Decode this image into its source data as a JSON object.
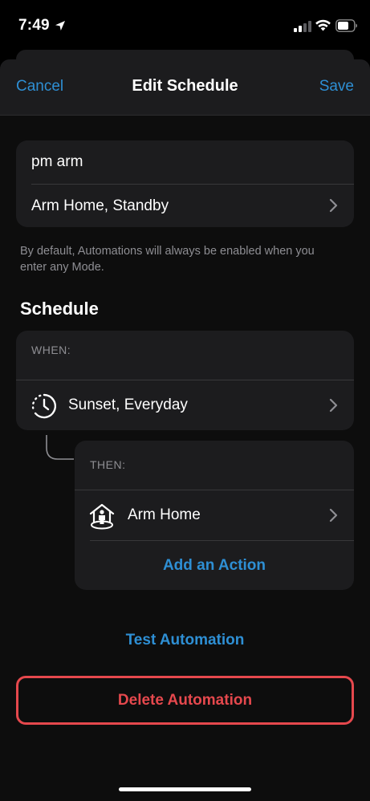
{
  "status_bar": {
    "time": "7:49"
  },
  "nav": {
    "cancel": "Cancel",
    "title": "Edit Schedule",
    "save": "Save"
  },
  "automation": {
    "name": "pm arm",
    "modes": "Arm Home, Standby",
    "footnote": "By default, Automations will always be enabled when you enter any Mode."
  },
  "schedule": {
    "title": "Schedule",
    "when_label": "WHEN:",
    "when_value": "Sunset, Everyday",
    "then_label": "THEN:",
    "then_value": "Arm Home",
    "add_action": "Add an Action"
  },
  "buttons": {
    "test": "Test Automation",
    "delete": "Delete Automation"
  },
  "icons": {
    "location": "location-arrow-icon",
    "signal": "cellular-signal-icon",
    "wifi": "wifi-icon",
    "battery": "battery-icon",
    "when": "clock-history-icon",
    "then": "arm-home-icon",
    "chevron": "chevron-right-icon"
  },
  "colors": {
    "accent": "#2e8fd4",
    "danger": "#e5484d",
    "card": "#1c1c1e",
    "secondary_text": "#8e8e93"
  }
}
